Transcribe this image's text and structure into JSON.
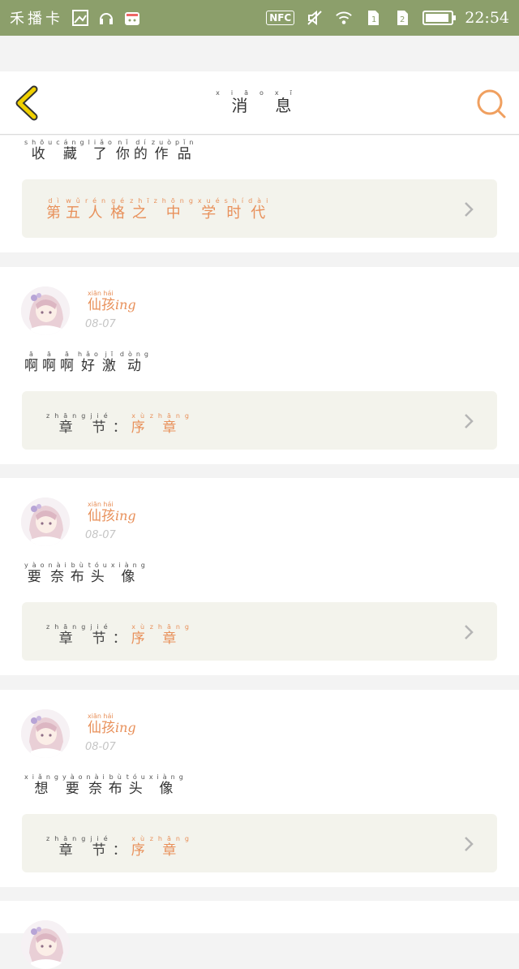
{
  "status_bar": {
    "left_text": "禾播卡",
    "nfc": "NFC",
    "time": "22:54",
    "battery_level": 0.92,
    "icons": [
      "image-icon",
      "headset-icon",
      "app-store-icon",
      "mute-icon",
      "wifi-icon",
      "sim1-icon",
      "sim2-icon",
      "battery-icon"
    ]
  },
  "header": {
    "title": [
      {
        "c": "消",
        "p": "xiāo"
      },
      {
        "c": "息",
        "p": "xī"
      }
    ],
    "back_icon": "chevron-left-icon",
    "search_icon": "search-icon",
    "accent": "#f0a060",
    "back_color": "#f0d000"
  },
  "first_card": {
    "message": [
      {
        "c": "收",
        "p": "shōu"
      },
      {
        "c": "藏",
        "p": "cáng"
      },
      {
        "c": "了",
        "p": "liǎo"
      },
      {
        "c": "你",
        "p": "nǐ"
      },
      {
        "c": "的",
        "p": "dí"
      },
      {
        "c": "作",
        "p": "zuò"
      },
      {
        "c": "品",
        "p": "pǐn"
      }
    ],
    "work_title": [
      {
        "c": "第",
        "p": "dì"
      },
      {
        "c": "五",
        "p": "wǔ"
      },
      {
        "c": "人",
        "p": "rén"
      },
      {
        "c": "格",
        "p": "gé"
      },
      {
        "c": "之",
        "p": "zhī"
      },
      {
        "c": "中",
        "p": "zhōng"
      },
      {
        "c": "学",
        "p": "xué"
      },
      {
        "c": "时",
        "p": "shí"
      },
      {
        "c": "代",
        "p": "dài"
      }
    ]
  },
  "user": {
    "name": [
      {
        "c": "仙",
        "p": "xiān"
      },
      {
        "c": "孩",
        "p": "hái"
      }
    ],
    "name_suffix": "ing"
  },
  "chapter_label": [
    {
      "c": "章",
      "p": "zhāng"
    },
    {
      "c": "节",
      "p": "jié"
    },
    {
      "c": "：",
      "p": ""
    }
  ],
  "chapter_value": [
    {
      "c": "序",
      "p": "xù"
    },
    {
      "c": "章",
      "p": "zhāng"
    }
  ],
  "comments": [
    {
      "date": "08-07",
      "message": [
        {
          "c": "啊",
          "p": "ā"
        },
        {
          "c": "啊",
          "p": "ā"
        },
        {
          "c": "啊",
          "p": "ā"
        },
        {
          "c": "好",
          "p": "hǎo"
        },
        {
          "c": "激",
          "p": "jī"
        },
        {
          "c": "动",
          "p": "dòng"
        }
      ]
    },
    {
      "date": "08-07",
      "message": [
        {
          "c": "要",
          "p": "yào"
        },
        {
          "c": "奈",
          "p": "nài"
        },
        {
          "c": "布",
          "p": "bù"
        },
        {
          "c": "头",
          "p": "tóu"
        },
        {
          "c": "像",
          "p": "xiàng"
        }
      ]
    },
    {
      "date": "08-07",
      "message": [
        {
          "c": "想",
          "p": "xiǎng"
        },
        {
          "c": "要",
          "p": "yào"
        },
        {
          "c": "奈",
          "p": "nài"
        },
        {
          "c": "布",
          "p": "bù"
        },
        {
          "c": "头",
          "p": "tóu"
        },
        {
          "c": "像",
          "p": "xiàng"
        }
      ]
    }
  ]
}
